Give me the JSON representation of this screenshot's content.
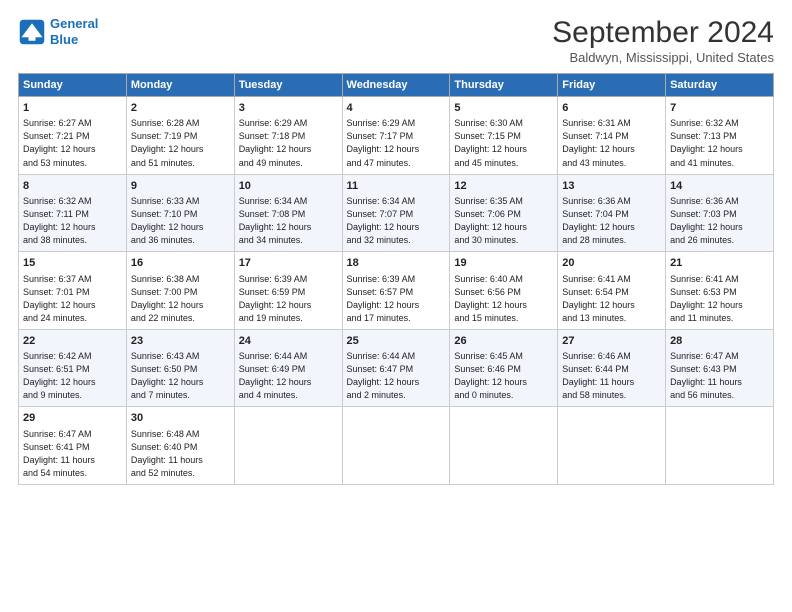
{
  "header": {
    "logo_line1": "General",
    "logo_line2": "Blue",
    "title": "September 2024",
    "subtitle": "Baldwyn, Mississippi, United States"
  },
  "days_of_week": [
    "Sunday",
    "Monday",
    "Tuesday",
    "Wednesday",
    "Thursday",
    "Friday",
    "Saturday"
  ],
  "weeks": [
    [
      {
        "day": "1",
        "lines": [
          "Sunrise: 6:27 AM",
          "Sunset: 7:21 PM",
          "Daylight: 12 hours",
          "and 53 minutes."
        ]
      },
      {
        "day": "2",
        "lines": [
          "Sunrise: 6:28 AM",
          "Sunset: 7:19 PM",
          "Daylight: 12 hours",
          "and 51 minutes."
        ]
      },
      {
        "day": "3",
        "lines": [
          "Sunrise: 6:29 AM",
          "Sunset: 7:18 PM",
          "Daylight: 12 hours",
          "and 49 minutes."
        ]
      },
      {
        "day": "4",
        "lines": [
          "Sunrise: 6:29 AM",
          "Sunset: 7:17 PM",
          "Daylight: 12 hours",
          "and 47 minutes."
        ]
      },
      {
        "day": "5",
        "lines": [
          "Sunrise: 6:30 AM",
          "Sunset: 7:15 PM",
          "Daylight: 12 hours",
          "and 45 minutes."
        ]
      },
      {
        "day": "6",
        "lines": [
          "Sunrise: 6:31 AM",
          "Sunset: 7:14 PM",
          "Daylight: 12 hours",
          "and 43 minutes."
        ]
      },
      {
        "day": "7",
        "lines": [
          "Sunrise: 6:32 AM",
          "Sunset: 7:13 PM",
          "Daylight: 12 hours",
          "and 41 minutes."
        ]
      }
    ],
    [
      {
        "day": "8",
        "lines": [
          "Sunrise: 6:32 AM",
          "Sunset: 7:11 PM",
          "Daylight: 12 hours",
          "and 38 minutes."
        ]
      },
      {
        "day": "9",
        "lines": [
          "Sunrise: 6:33 AM",
          "Sunset: 7:10 PM",
          "Daylight: 12 hours",
          "and 36 minutes."
        ]
      },
      {
        "day": "10",
        "lines": [
          "Sunrise: 6:34 AM",
          "Sunset: 7:08 PM",
          "Daylight: 12 hours",
          "and 34 minutes."
        ]
      },
      {
        "day": "11",
        "lines": [
          "Sunrise: 6:34 AM",
          "Sunset: 7:07 PM",
          "Daylight: 12 hours",
          "and 32 minutes."
        ]
      },
      {
        "day": "12",
        "lines": [
          "Sunrise: 6:35 AM",
          "Sunset: 7:06 PM",
          "Daylight: 12 hours",
          "and 30 minutes."
        ]
      },
      {
        "day": "13",
        "lines": [
          "Sunrise: 6:36 AM",
          "Sunset: 7:04 PM",
          "Daylight: 12 hours",
          "and 28 minutes."
        ]
      },
      {
        "day": "14",
        "lines": [
          "Sunrise: 6:36 AM",
          "Sunset: 7:03 PM",
          "Daylight: 12 hours",
          "and 26 minutes."
        ]
      }
    ],
    [
      {
        "day": "15",
        "lines": [
          "Sunrise: 6:37 AM",
          "Sunset: 7:01 PM",
          "Daylight: 12 hours",
          "and 24 minutes."
        ]
      },
      {
        "day": "16",
        "lines": [
          "Sunrise: 6:38 AM",
          "Sunset: 7:00 PM",
          "Daylight: 12 hours",
          "and 22 minutes."
        ]
      },
      {
        "day": "17",
        "lines": [
          "Sunrise: 6:39 AM",
          "Sunset: 6:59 PM",
          "Daylight: 12 hours",
          "and 19 minutes."
        ]
      },
      {
        "day": "18",
        "lines": [
          "Sunrise: 6:39 AM",
          "Sunset: 6:57 PM",
          "Daylight: 12 hours",
          "and 17 minutes."
        ]
      },
      {
        "day": "19",
        "lines": [
          "Sunrise: 6:40 AM",
          "Sunset: 6:56 PM",
          "Daylight: 12 hours",
          "and 15 minutes."
        ]
      },
      {
        "day": "20",
        "lines": [
          "Sunrise: 6:41 AM",
          "Sunset: 6:54 PM",
          "Daylight: 12 hours",
          "and 13 minutes."
        ]
      },
      {
        "day": "21",
        "lines": [
          "Sunrise: 6:41 AM",
          "Sunset: 6:53 PM",
          "Daylight: 12 hours",
          "and 11 minutes."
        ]
      }
    ],
    [
      {
        "day": "22",
        "lines": [
          "Sunrise: 6:42 AM",
          "Sunset: 6:51 PM",
          "Daylight: 12 hours",
          "and 9 minutes."
        ]
      },
      {
        "day": "23",
        "lines": [
          "Sunrise: 6:43 AM",
          "Sunset: 6:50 PM",
          "Daylight: 12 hours",
          "and 7 minutes."
        ]
      },
      {
        "day": "24",
        "lines": [
          "Sunrise: 6:44 AM",
          "Sunset: 6:49 PM",
          "Daylight: 12 hours",
          "and 4 minutes."
        ]
      },
      {
        "day": "25",
        "lines": [
          "Sunrise: 6:44 AM",
          "Sunset: 6:47 PM",
          "Daylight: 12 hours",
          "and 2 minutes."
        ]
      },
      {
        "day": "26",
        "lines": [
          "Sunrise: 6:45 AM",
          "Sunset: 6:46 PM",
          "Daylight: 12 hours",
          "and 0 minutes."
        ]
      },
      {
        "day": "27",
        "lines": [
          "Sunrise: 6:46 AM",
          "Sunset: 6:44 PM",
          "Daylight: 11 hours",
          "and 58 minutes."
        ]
      },
      {
        "day": "28",
        "lines": [
          "Sunrise: 6:47 AM",
          "Sunset: 6:43 PM",
          "Daylight: 11 hours",
          "and 56 minutes."
        ]
      }
    ],
    [
      {
        "day": "29",
        "lines": [
          "Sunrise: 6:47 AM",
          "Sunset: 6:41 PM",
          "Daylight: 11 hours",
          "and 54 minutes."
        ]
      },
      {
        "day": "30",
        "lines": [
          "Sunrise: 6:48 AM",
          "Sunset: 6:40 PM",
          "Daylight: 11 hours",
          "and 52 minutes."
        ]
      },
      {
        "day": "",
        "lines": []
      },
      {
        "day": "",
        "lines": []
      },
      {
        "day": "",
        "lines": []
      },
      {
        "day": "",
        "lines": []
      },
      {
        "day": "",
        "lines": []
      }
    ]
  ]
}
